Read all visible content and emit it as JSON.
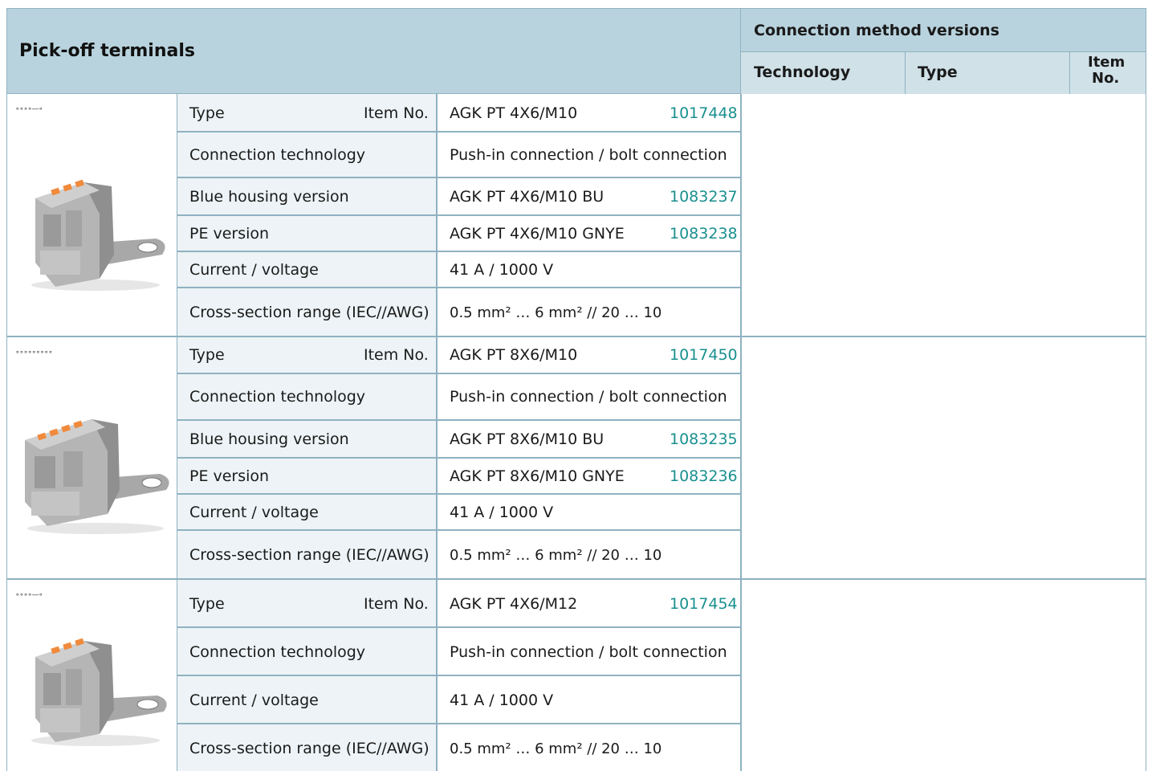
{
  "header": {
    "title": "Pick-off terminals",
    "connection_methods": "Connection method versions",
    "col_technology": "Technology",
    "col_type": "Type",
    "col_item_line1": "Item",
    "col_item_line2": "No."
  },
  "sections": [
    {
      "symbol": "∘∘∘∘—∘",
      "type_label": "Type",
      "itemno_label": "Item No.",
      "type_value": "AGK PT 4X6/M10",
      "type_item": "1017448",
      "conn_label": "Connection technology",
      "conn_value": "Push-in connection / bolt connection",
      "blue_label": "Blue housing version",
      "blue_value": "AGK PT 4X6/M10 BU",
      "blue_item": "1083237",
      "pe_label": "PE version",
      "pe_value": "AGK PT 4X6/M10 GNYE",
      "pe_item": "1083238",
      "cv_label": "Current / voltage",
      "cv_value": "41 A / 1000 V",
      "cs_label": "Cross-section range (IEC//AWG)",
      "cs_value": "0.5 mm² … 6 mm² // 20 … 10"
    },
    {
      "symbol": "∘∘∘∘∘∘∘∘∘",
      "type_label": "Type",
      "itemno_label": "Item No.",
      "type_value": "AGK PT 8X6/M10",
      "type_item": "1017450",
      "conn_label": "Connection technology",
      "conn_value": "Push-in connection / bolt connection",
      "blue_label": "Blue housing version",
      "blue_value": "AGK PT 8X6/M10 BU",
      "blue_item": "1083235",
      "pe_label": "PE version",
      "pe_value": "AGK PT 8X6/M10 GNYE",
      "pe_item": "1083236",
      "cv_label": "Current / voltage",
      "cv_value": "41 A / 1000 V",
      "cs_label": "Cross-section range (IEC//AWG)",
      "cs_value": "0.5 mm² … 6 mm² // 20 … 10"
    },
    {
      "symbol": "∘∘∘∘—∘",
      "type_label": "Type",
      "itemno_label": "Item No.",
      "type_value": "AGK PT 4X6/M12",
      "type_item": "1017454",
      "conn_label": "Connection technology",
      "conn_value": "Push-in connection / bolt connection",
      "cv_label": "Current / voltage",
      "cv_value": "41 A / 1000 V",
      "cs_label": "Cross-section range (IEC//AWG)",
      "cs_value": "0.5 mm² … 6 mm² // 20 … 10"
    }
  ],
  "colors": {
    "header_bg": "#b9d3de",
    "label_bg": "#edf3f6",
    "item_number": "#1a8f8f",
    "border": "#8fb2c1"
  }
}
